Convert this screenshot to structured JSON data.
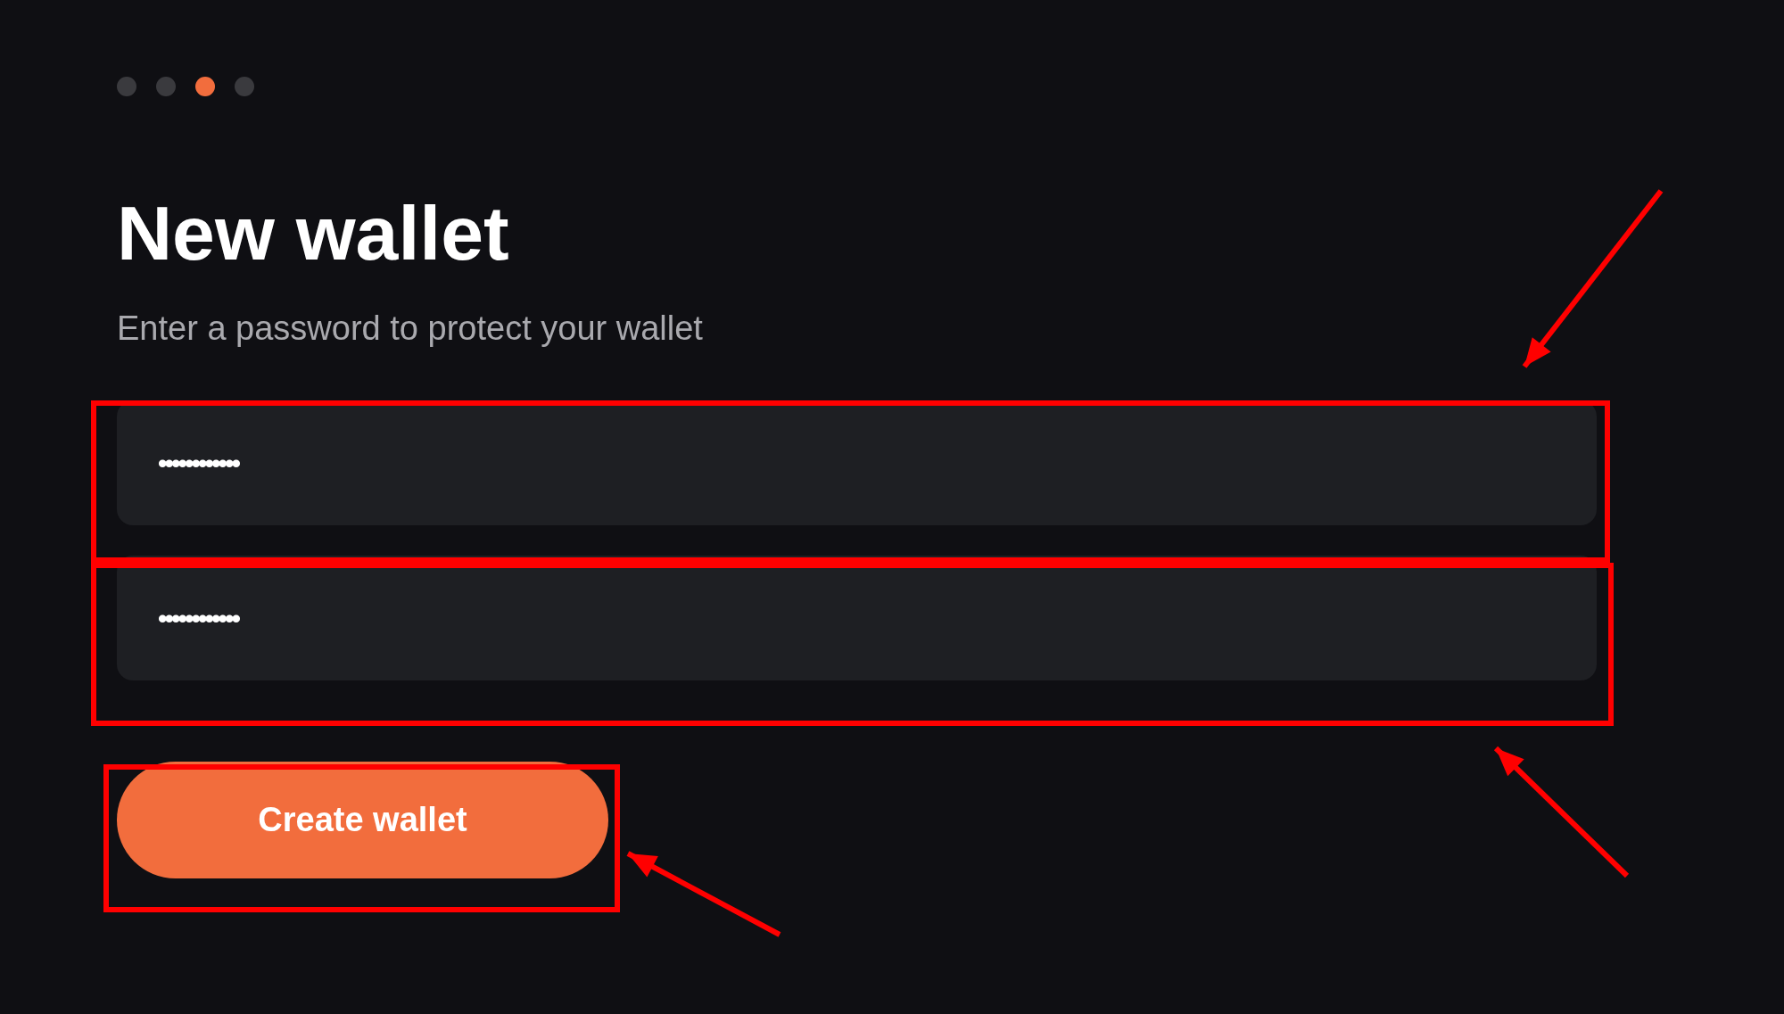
{
  "steps": [
    {
      "selected": false
    },
    {
      "selected": false
    },
    {
      "selected": true
    },
    {
      "selected": false
    }
  ],
  "title": "New wallet",
  "subtitle": "Enter a password to protect your wallet",
  "fields": [
    {
      "value": "••••••••••••"
    },
    {
      "value": "••••••••••••"
    }
  ],
  "button": "Create wallet"
}
